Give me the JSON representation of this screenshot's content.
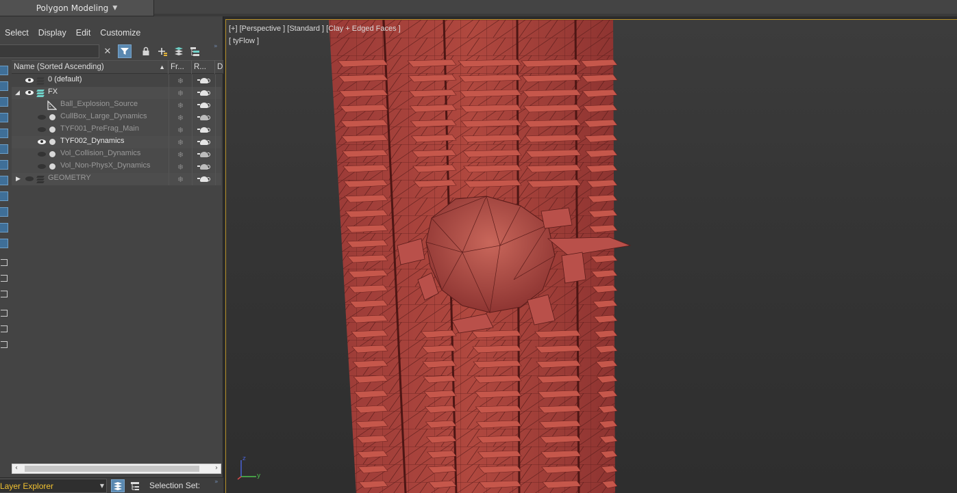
{
  "ribbon": {
    "active_tab": "Polygon Modeling"
  },
  "explorer": {
    "menu": [
      "Select",
      "Display",
      "Edit",
      "Customize"
    ],
    "search_value": "",
    "columns": {
      "name": "Name (Sorted Ascending)",
      "frozen": "Fr...",
      "render": "R...",
      "display": "D"
    },
    "rows": [
      {
        "name": "0 (default)",
        "level": 0,
        "type": "layer",
        "visible": true,
        "bright": true
      },
      {
        "name": "FX",
        "level": 0,
        "type": "layer-open",
        "visible": true,
        "bright": true
      },
      {
        "name": "Ball_Explosion_Source",
        "level": 1,
        "type": "helper",
        "visible": false,
        "bright": false
      },
      {
        "name": "CullBox_Large_Dynamics",
        "level": 1,
        "type": "object",
        "visible": false,
        "bright": false
      },
      {
        "name": "TYF001_PreFrag_Main",
        "level": 1,
        "type": "object",
        "visible": false,
        "bright": false
      },
      {
        "name": "TYF002_Dynamics",
        "level": 1,
        "type": "object",
        "visible": true,
        "bright": true
      },
      {
        "name": "Vol_Collision_Dynamics",
        "level": 1,
        "type": "object",
        "visible": false,
        "bright": false
      },
      {
        "name": "Vol_Non-PhysX_Dynamics",
        "level": 1,
        "type": "object",
        "visible": false,
        "bright": false
      },
      {
        "name": "GEOMETRY",
        "level": 0,
        "type": "layer-closed",
        "visible": false,
        "bright": false
      }
    ]
  },
  "bottombar": {
    "explorer_name": "Layer Explorer",
    "selection_set_label": "Selection Set:"
  },
  "viewport": {
    "label": "[+] [Perspective ] [Standard ] [Clay + Edged Faces ]",
    "label2": "[ tyFlow ]",
    "gizmo_z": "z",
    "gizmo_y": "y"
  },
  "colors": {
    "accent": "#5a88b0",
    "viewport_border": "#b9932a",
    "explorer_label": "#f2c231",
    "clay": "#a8403b"
  }
}
